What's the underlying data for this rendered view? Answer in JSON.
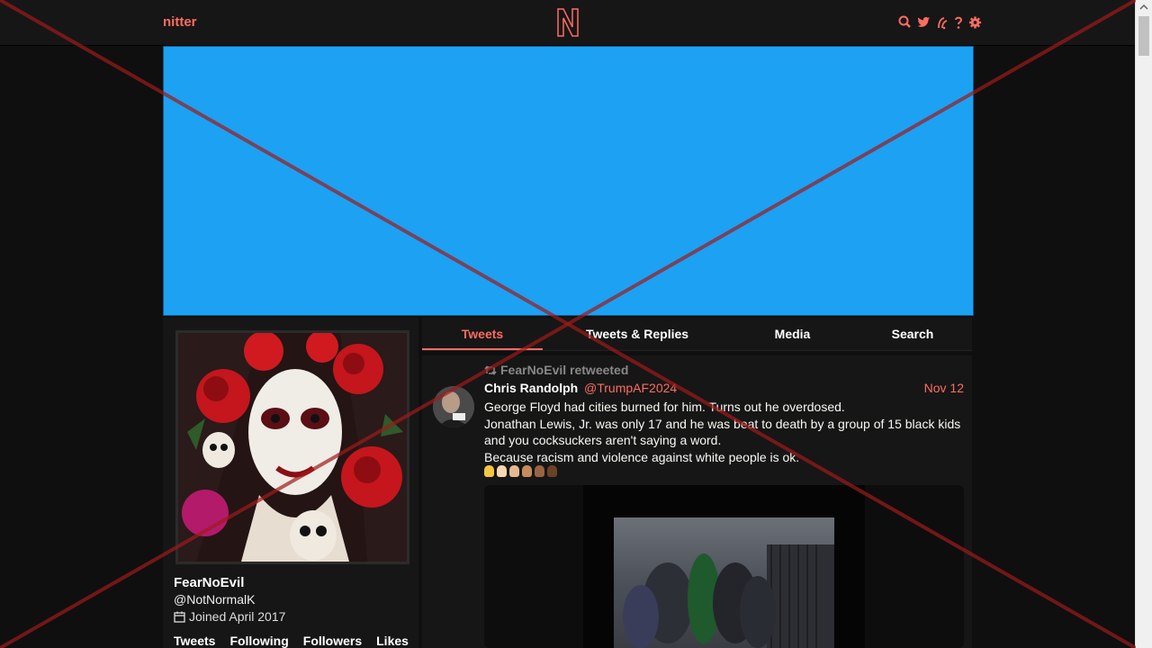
{
  "nav": {
    "brand": "nitter",
    "logo_letter": "N",
    "icons": [
      "search-icon",
      "twitter-icon",
      "rss-icon",
      "help-icon",
      "settings-icon"
    ]
  },
  "banner": {
    "color": "#1da1f2"
  },
  "profile": {
    "name": "FearNoEvil",
    "handle": "@NotNormalK",
    "joined": "Joined April 2017",
    "stats": [
      "Tweets",
      "Following",
      "Followers",
      "Likes"
    ]
  },
  "tabs": [
    {
      "label": "Tweets",
      "active": true
    },
    {
      "label": "Tweets & Replies",
      "active": false
    },
    {
      "label": "Media",
      "active": false
    },
    {
      "label": "Search",
      "active": false
    }
  ],
  "tweet": {
    "retweet_label": "FearNoEvil retweeted",
    "fullname": "Chris Randolph",
    "username": "@TrumpAF2024",
    "date": "Nov 12",
    "lines": [
      "George Floyd had cities burned for him. Turns out he overdosed.",
      "Jonathan Lewis, Jr. was only 17 and he was beat to death by a group of 15 black kids",
      "and you cocksuckers aren't saying a word.",
      "Because racism and violence against white people is ok."
    ],
    "emoji_colors": [
      "#f5c542",
      "#f7d7b0",
      "#e4b990",
      "#c48b5e",
      "#9a6442",
      "#6b4226"
    ]
  },
  "colors": {
    "accent": "#ff6c60",
    "bg": "#0f0f0f",
    "panel": "#161616"
  }
}
